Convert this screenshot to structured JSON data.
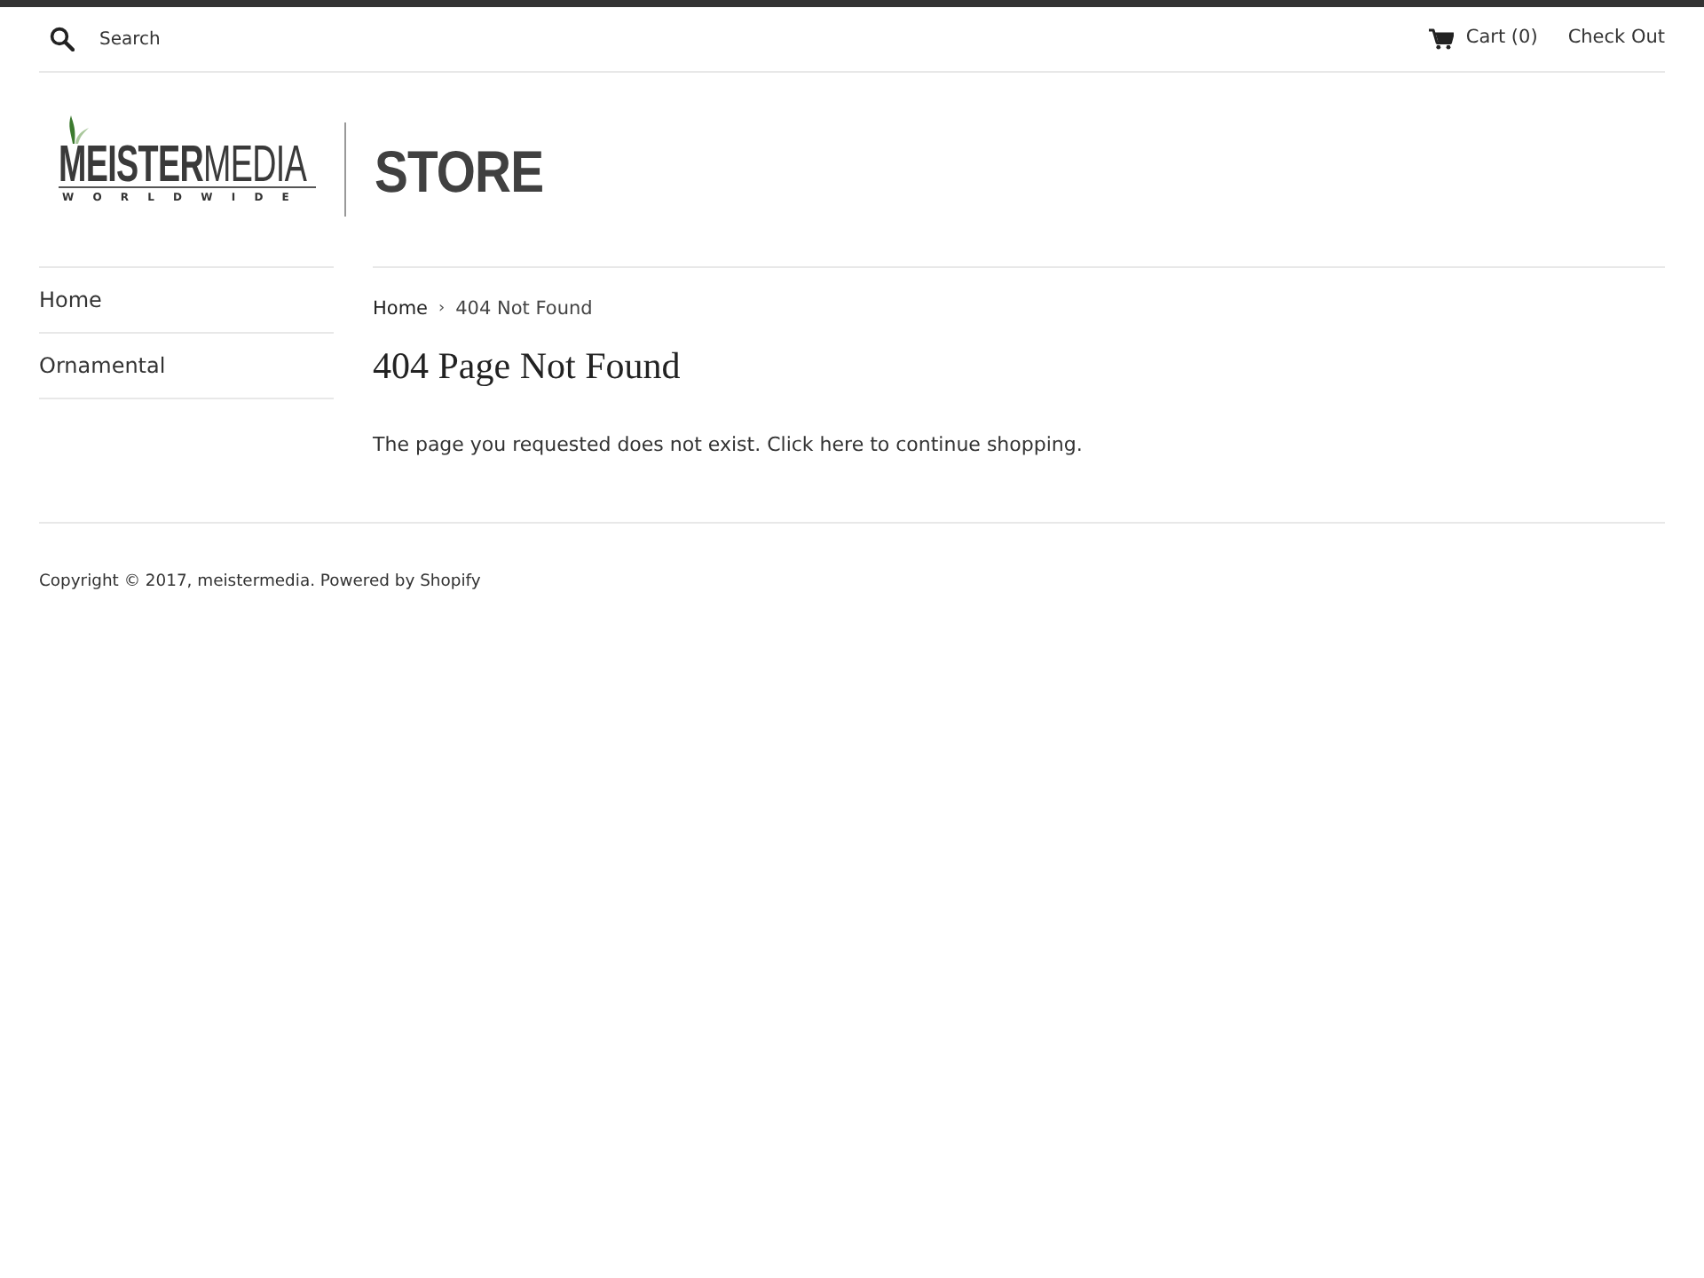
{
  "header": {
    "search": {
      "placeholder": "Search"
    },
    "cart": {
      "label": "Cart (0)"
    },
    "checkout": {
      "label": "Check Out"
    }
  },
  "logo": {
    "wordmark": "**MEISTER**MEDIA",
    "tagline": "WORLDWIDE",
    "store": "STORE"
  },
  "sidebar": {
    "items": [
      {
        "label": "Home"
      },
      {
        "label": "Ornamental"
      }
    ]
  },
  "breadcrumb": [
    {
      "kind": "link",
      "label": "Home"
    },
    {
      "kind": "separator",
      "label": "›"
    },
    {
      "kind": "current",
      "label": "404 Not Found"
    }
  ],
  "page": {
    "title": "404 Page Not Found",
    "message": "The page you requested does not exist. Click here to continue shopping."
  },
  "footer": {
    "copyright": "Copyright © 2017, meistermedia. Powered by Shopify"
  }
}
